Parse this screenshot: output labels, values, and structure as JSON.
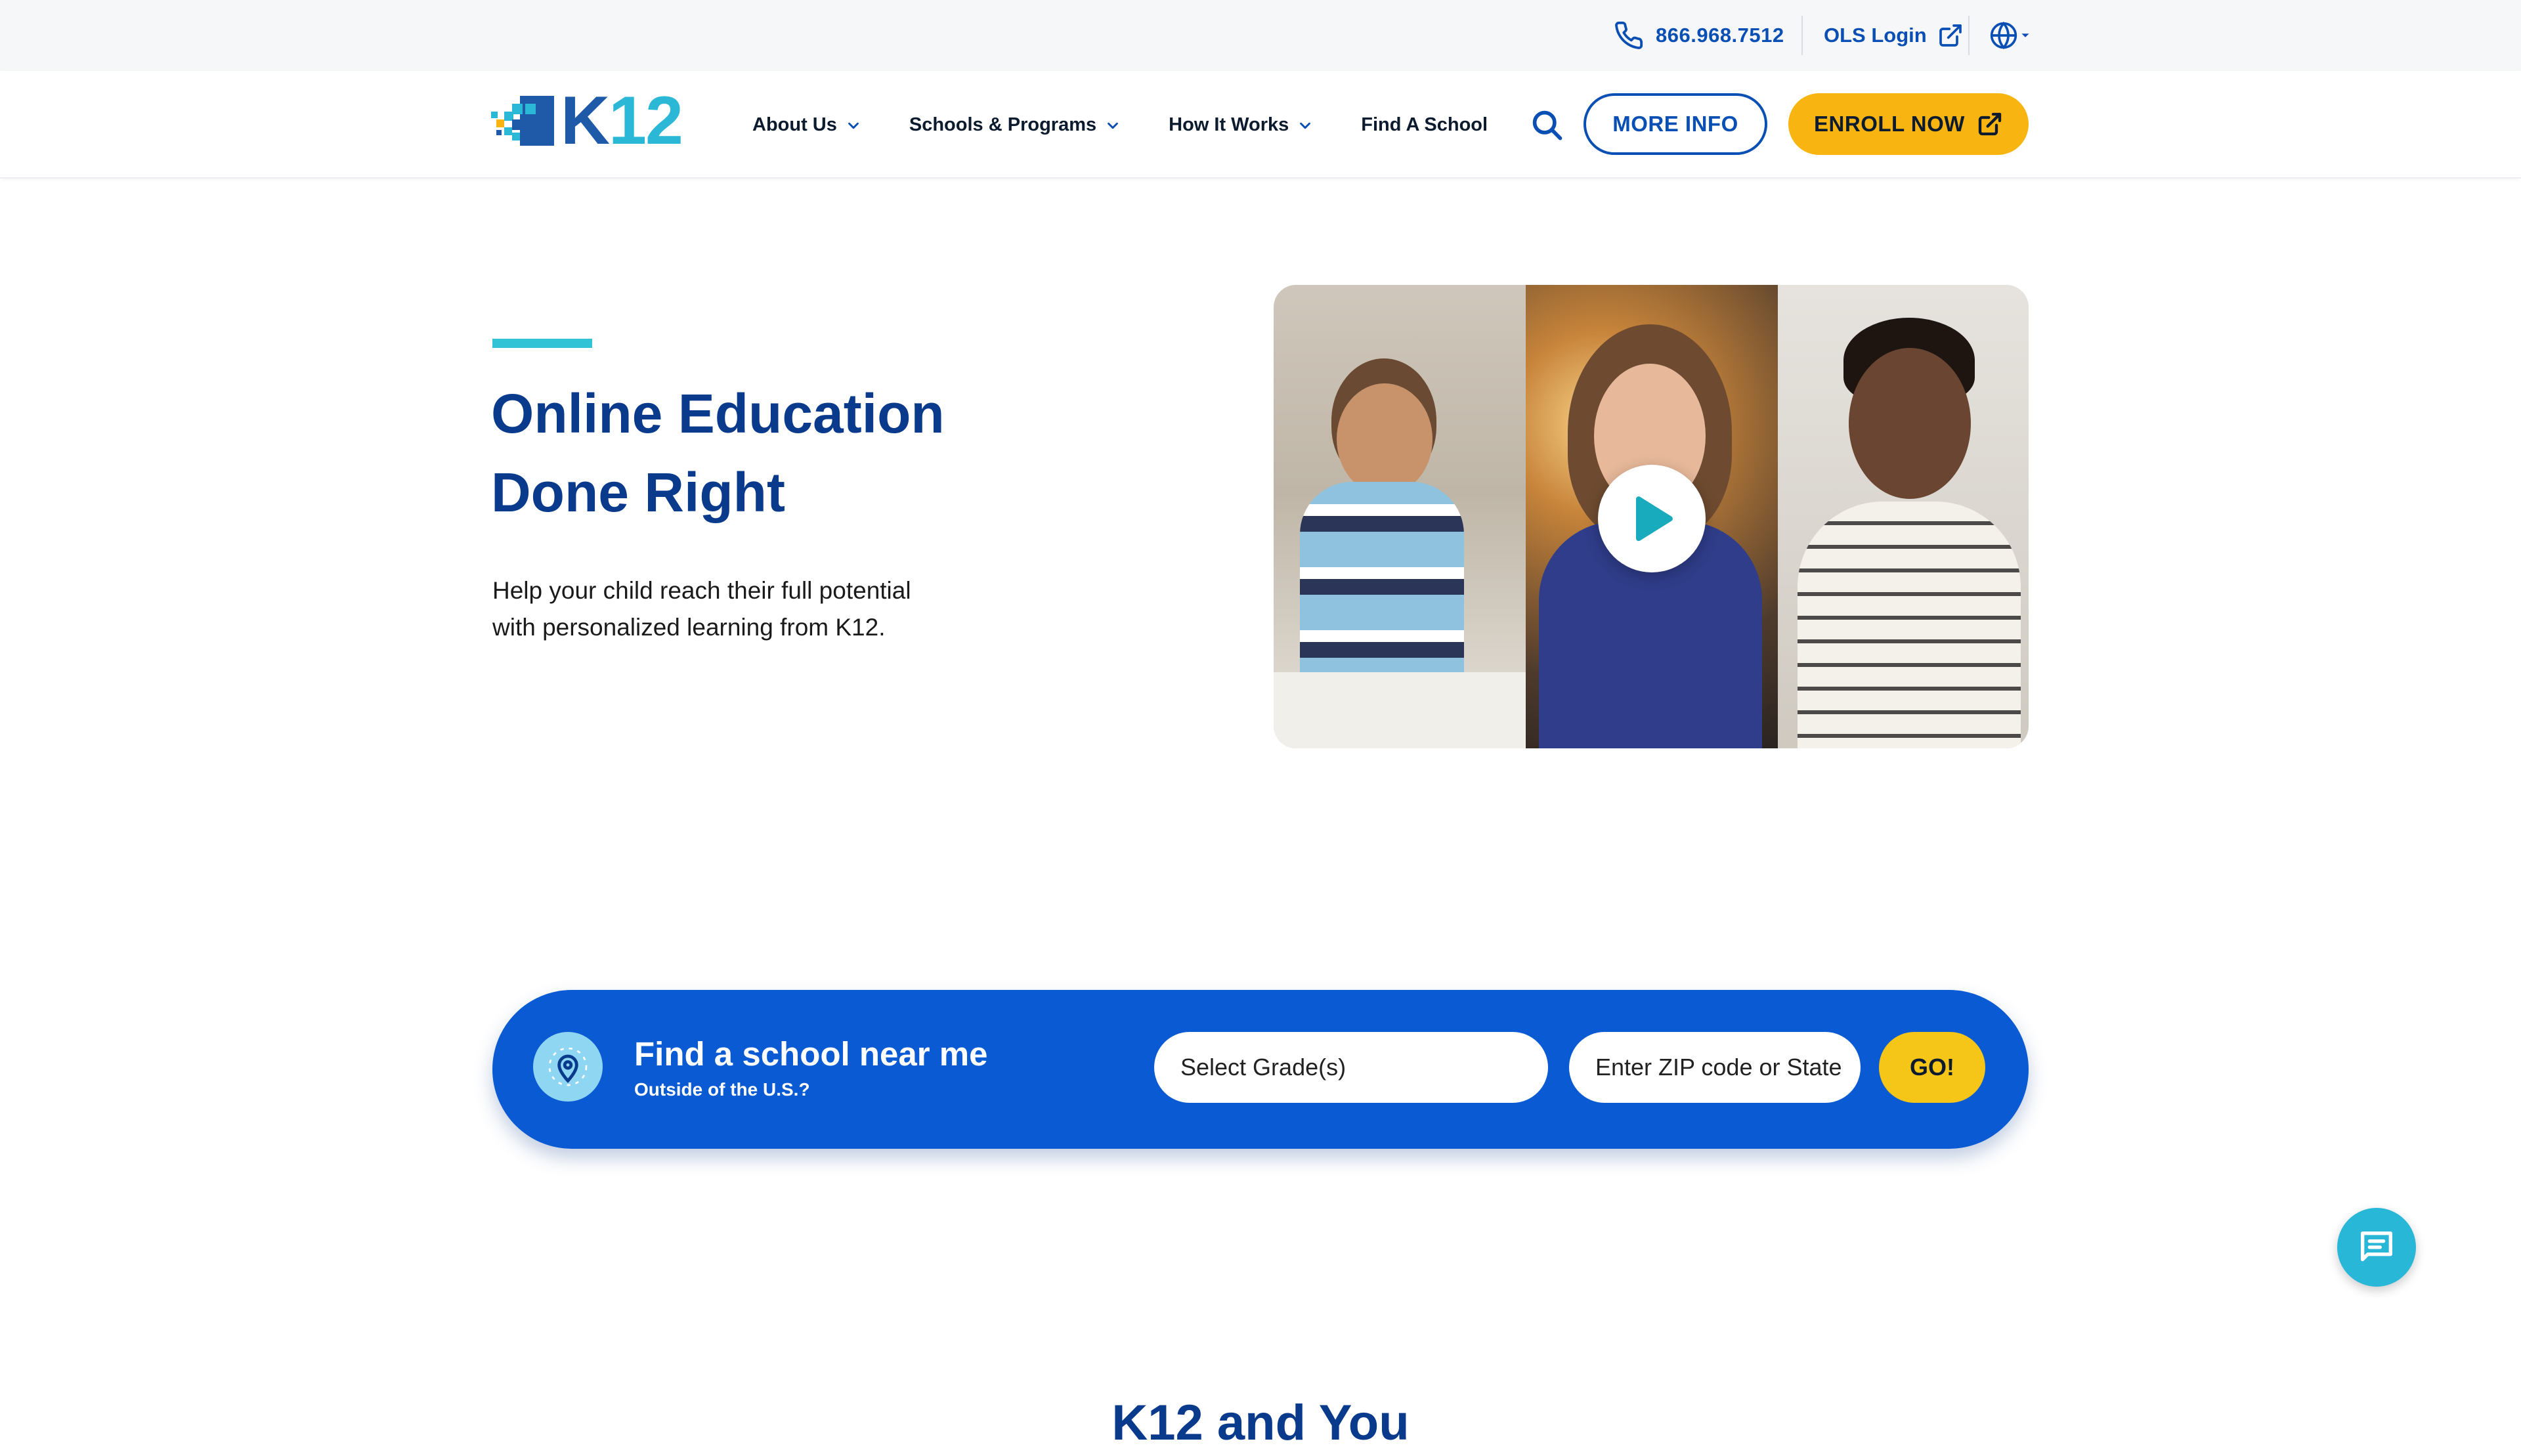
{
  "utility_bar": {
    "phone": "866.968.7512",
    "login_label": "OLS Login",
    "icons": [
      "phone-icon",
      "external-link-icon",
      "globe-icon"
    ]
  },
  "nav": {
    "logo_text_k": "K",
    "logo_text_n": "12",
    "items": [
      {
        "label": "About Us",
        "has_dropdown": true
      },
      {
        "label": "Schools & Programs",
        "has_dropdown": true
      },
      {
        "label": "How It Works",
        "has_dropdown": true
      },
      {
        "label": "Find A School",
        "has_dropdown": false
      }
    ],
    "more_info_label": "MORE INFO",
    "enroll_label": "ENROLL NOW"
  },
  "hero": {
    "title_line1": "Online Education",
    "title_line2": "Done Right",
    "subtitle_line1": "Help your child reach their full potential",
    "subtitle_line2": "with personalized learning from K12."
  },
  "finder": {
    "title": "Find a school near me",
    "outside_link": "Outside of the U.S.?",
    "grade_select": "Select Grade(s)",
    "zip_placeholder": "Enter ZIP code or State",
    "go_label": "GO!"
  },
  "next_section": {
    "heading": "K12 and You"
  },
  "colors": {
    "brand_blue": "#0a5bd3",
    "heading_navy": "#0a3a8c",
    "accent_yellow": "#f8b411",
    "accent_teal": "#33c3d6"
  }
}
